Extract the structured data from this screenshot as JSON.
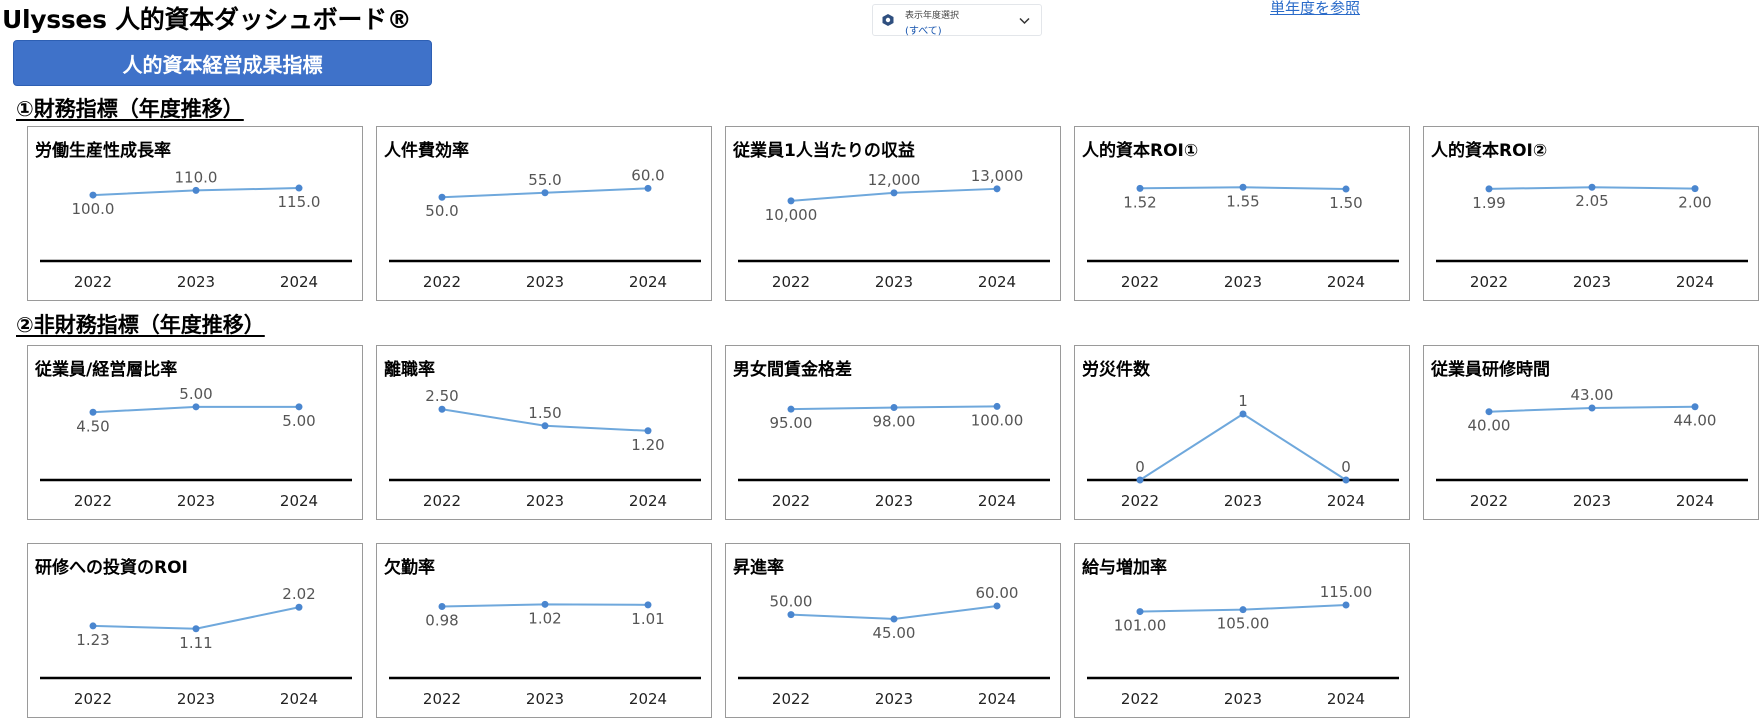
{
  "app": {
    "title": "Ulysses 人的資本ダッシュボード®"
  },
  "filter": {
    "label": "表示年度選択",
    "value": "(すべて)"
  },
  "link": {
    "single_year": "単年度を参照"
  },
  "banner": {
    "label": "人的資本経営成果指標"
  },
  "sections": [
    {
      "title": "①財務指標（年度推移）"
    },
    {
      "title": "②非財務指標（年度推移）"
    }
  ],
  "colors": {
    "accent": "#3f72c9",
    "line": "#6fa8dc",
    "point": "#4a86cf"
  },
  "chart_data": [
    {
      "type": "line",
      "title": "労働生産性成長率",
      "categories": [
        "2022",
        "2023",
        "2024"
      ],
      "values": [
        100.0,
        110.0,
        115.0
      ],
      "labels": [
        "100.0",
        "110.0",
        "115.0"
      ]
    },
    {
      "type": "line",
      "title": "人件費効率",
      "categories": [
        "2022",
        "2023",
        "2024"
      ],
      "values": [
        50.0,
        55.0,
        60.0
      ],
      "labels": [
        "50.0",
        "55.0",
        "60.0"
      ]
    },
    {
      "type": "line",
      "title": "従業員1人当たりの収益",
      "categories": [
        "2022",
        "2023",
        "2024"
      ],
      "values": [
        10000,
        12000,
        13000
      ],
      "labels": [
        "10,000",
        "12,000",
        "13,000"
      ]
    },
    {
      "type": "line",
      "title": "人的資本ROI①",
      "categories": [
        "2022",
        "2023",
        "2024"
      ],
      "values": [
        1.52,
        1.55,
        1.5
      ],
      "labels": [
        "1.52",
        "1.55",
        "1.50"
      ]
    },
    {
      "type": "line",
      "title": "人的資本ROI②",
      "categories": [
        "2022",
        "2023",
        "2024"
      ],
      "values": [
        1.99,
        2.05,
        2.0
      ],
      "labels": [
        "1.99",
        "2.05",
        "2.00"
      ]
    },
    {
      "type": "line",
      "title": "従業員/経営層比率",
      "categories": [
        "2022",
        "2023",
        "2024"
      ],
      "values": [
        4.5,
        5.0,
        5.0
      ],
      "labels": [
        "4.50",
        "5.00",
        "5.00"
      ]
    },
    {
      "type": "line",
      "title": "離職率",
      "categories": [
        "2022",
        "2023",
        "2024"
      ],
      "values": [
        2.5,
        1.5,
        1.2
      ],
      "labels": [
        "2.50",
        "1.50",
        "1.20"
      ]
    },
    {
      "type": "line",
      "title": "男女間賃金格差",
      "categories": [
        "2022",
        "2023",
        "2024"
      ],
      "values": [
        95.0,
        98.0,
        100.0
      ],
      "labels": [
        "95.00",
        "98.00",
        "100.00"
      ]
    },
    {
      "type": "line",
      "title": "労災件数",
      "categories": [
        "2022",
        "2023",
        "2024"
      ],
      "values": [
        0,
        1,
        0
      ],
      "labels": [
        "0",
        "1",
        "0"
      ]
    },
    {
      "type": "line",
      "title": "従業員研修時間",
      "categories": [
        "2022",
        "2023",
        "2024"
      ],
      "values": [
        40.0,
        43.0,
        44.0
      ],
      "labels": [
        "40.00",
        "43.00",
        "44.00"
      ]
    },
    {
      "type": "line",
      "title": "研修への投資のROI",
      "categories": [
        "2022",
        "2023",
        "2024"
      ],
      "values": [
        1.23,
        1.11,
        2.02
      ],
      "labels": [
        "1.23",
        "1.11",
        "2.02"
      ]
    },
    {
      "type": "line",
      "title": "欠勤率",
      "categories": [
        "2022",
        "2023",
        "2024"
      ],
      "values": [
        0.98,
        1.02,
        1.01
      ],
      "labels": [
        "0.98",
        "1.02",
        "1.01"
      ]
    },
    {
      "type": "line",
      "title": "昇進率",
      "categories": [
        "2022",
        "2023",
        "2024"
      ],
      "values": [
        50.0,
        45.0,
        60.0
      ],
      "labels": [
        "50.00",
        "45.00",
        "60.00"
      ]
    },
    {
      "type": "line",
      "title": "給与増加率",
      "categories": [
        "2022",
        "2023",
        "2024"
      ],
      "values": [
        101.0,
        105.0,
        115.0
      ],
      "labels": [
        "101.00",
        "105.00",
        "115.00"
      ]
    }
  ]
}
